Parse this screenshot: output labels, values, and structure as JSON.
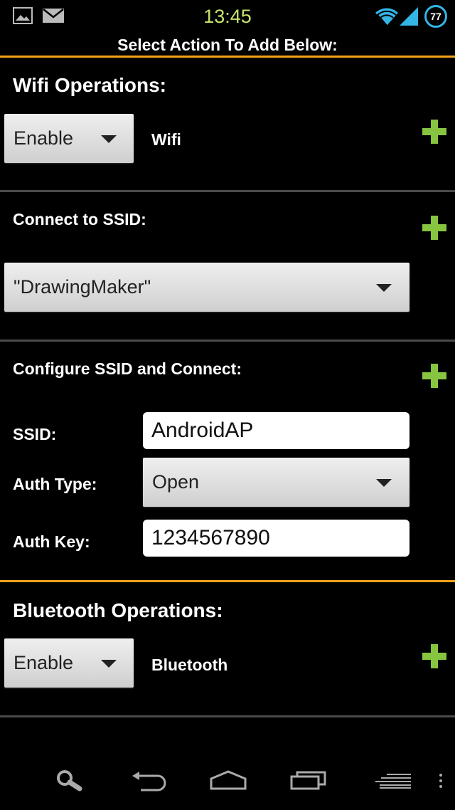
{
  "status_bar": {
    "time": "13:45",
    "battery_level": "77",
    "icons": [
      "image-icon",
      "mail-icon",
      "wifi-icon",
      "signal-icon",
      "battery-icon"
    ]
  },
  "header": {
    "title": "Select Action To Add Below:"
  },
  "wifi_ops": {
    "title": "Wifi Operations:",
    "spinner_value": "Enable",
    "target_label": "Wifi"
  },
  "connect_ssid": {
    "title": "Connect to SSID:",
    "spinner_value": "\"DrawingMaker\""
  },
  "configure": {
    "title": "Configure SSID and Connect:",
    "ssid_label": "SSID:",
    "ssid_value": "AndroidAP",
    "auth_type_label": "Auth Type:",
    "auth_type_value": "Open",
    "auth_key_label": "Auth Key:",
    "auth_key_value": "1234567890"
  },
  "bt_ops": {
    "title": "Bluetooth Operations:",
    "spinner_value": "Enable",
    "target_label": "Bluetooth"
  },
  "navbar": {
    "icons": [
      "search-icon",
      "back-icon",
      "home-icon",
      "recent-apps-icon",
      "menu-icon",
      "overflow-icon"
    ]
  },
  "colors": {
    "accent": "#f5a21a",
    "add": "#87c540",
    "clock": "#c6e46b",
    "battery": "#33b5e5"
  }
}
